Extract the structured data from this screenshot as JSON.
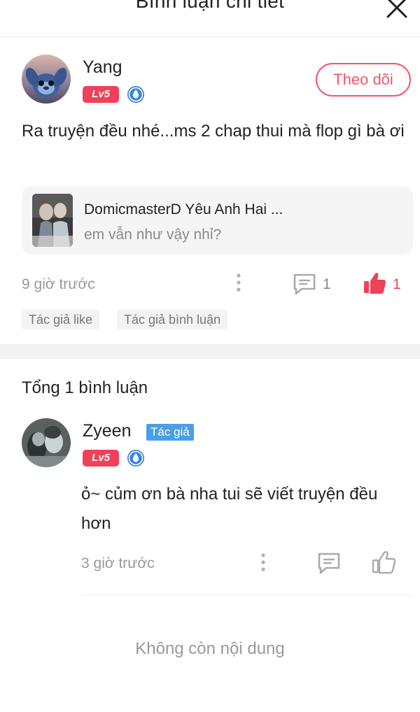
{
  "header": {
    "title": "Bình luận chi tiết"
  },
  "comment": {
    "user_name": "Yang",
    "level": "Lv5",
    "follow_label": "Theo dõi",
    "text": "Ra truyện đều nhé...ms 2 chap thui mà flop gì bà ơi",
    "quote": {
      "title": "DomicmasterD Yêu Anh Hai ...",
      "subtitle": "em vẫn như vậy nhỉ?"
    },
    "time": "9 giờ trước",
    "reply_count": "1",
    "like_count": "1",
    "tags": [
      "Tác giả like",
      "Tác giả bình luận"
    ]
  },
  "replies": {
    "total_label": "Tổng 1 bình luận",
    "items": [
      {
        "user_name": "Zyeen",
        "author_tag": "Tác giả",
        "level": "Lv5",
        "text": "ỏ~ củm ơn bà nha tui sẽ viết truyện đều hơn",
        "time": "3 giờ trước"
      }
    ]
  },
  "footer": {
    "end_text": "Không còn nội dung"
  },
  "colors": {
    "accent": "#f2566c",
    "like": "#f0405a",
    "author_tag": "#4a9fe6",
    "shield": "#3a86d6"
  }
}
